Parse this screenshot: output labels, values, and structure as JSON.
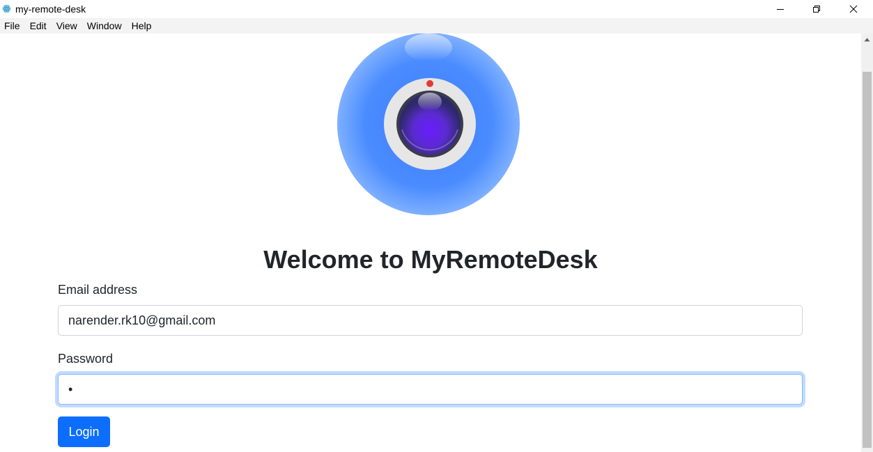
{
  "window": {
    "title": "my-remote-desk",
    "icon": "electron-atom-icon",
    "controls": {
      "minimize": "minimize-icon",
      "maximize": "restore-icon",
      "close": "close-icon"
    }
  },
  "menubar": {
    "items": [
      {
        "label": "File"
      },
      {
        "label": "Edit"
      },
      {
        "label": "View"
      },
      {
        "label": "Window"
      },
      {
        "label": "Help"
      }
    ]
  },
  "main": {
    "logo_icon": "webcam-icon",
    "heading": "Welcome to MyRemoteDesk",
    "email": {
      "label": "Email address",
      "value": "narender.rk10@gmail.com"
    },
    "password": {
      "label": "Password",
      "value": "•"
    },
    "login_label": "Login"
  },
  "colors": {
    "primary": "#0d6efd",
    "logo_blue": "#4a8cff",
    "lens_purple": "#6a1cff",
    "recording_dot": "#e53935"
  }
}
